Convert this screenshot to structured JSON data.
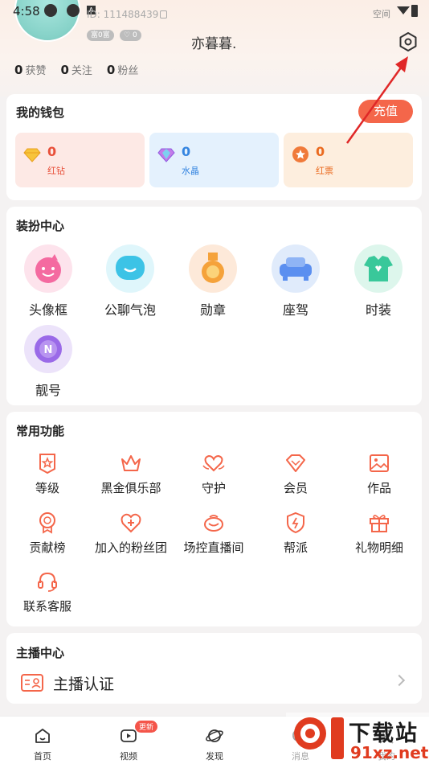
{
  "status_bar": {
    "time": "4:58",
    "network_label": "空间"
  },
  "profile": {
    "user_id": "ID: 111488439",
    "badge_wealth": "富0富",
    "badge_charm": "0",
    "nickname": "亦暮暮.",
    "stats": [
      {
        "count": "0",
        "label": "获赞"
      },
      {
        "count": "0",
        "label": "关注"
      },
      {
        "count": "0",
        "label": "粉丝"
      }
    ],
    "settings_icon": "settings-gear-icon"
  },
  "wallet": {
    "title": "我的钱包",
    "recharge_label": "充值",
    "items": [
      {
        "value": "0",
        "label": "红钻",
        "icon": "diamond-icon",
        "bg": "#fde9e5",
        "fg": "#e8503a"
      },
      {
        "value": "0",
        "label": "水晶",
        "icon": "crystal-icon",
        "bg": "#e4f1fd",
        "fg": "#3585e0"
      },
      {
        "value": "0",
        "label": "红票",
        "icon": "ticket-icon",
        "bg": "#fdeede",
        "fg": "#ea6a1f"
      }
    ]
  },
  "dressup": {
    "title": "装扮中心",
    "items": [
      {
        "label": "头像框",
        "icon": "avatar-frame-icon",
        "bg": "#fde3ec",
        "fg": "#f46aa0"
      },
      {
        "label": "公聊气泡",
        "icon": "chat-bubble-icon",
        "bg": "#dff6fb",
        "fg": "#3cc3e6"
      },
      {
        "label": "勋章",
        "icon": "medal-icon",
        "bg": "#fde9d9",
        "fg": "#f5a23a"
      },
      {
        "label": "座驾",
        "icon": "car-icon",
        "bg": "#e0ebfb",
        "fg": "#5b8ff0"
      },
      {
        "label": "时装",
        "icon": "clothes-icon",
        "bg": "#ddf6ec",
        "fg": "#39c89a"
      },
      {
        "label": "靓号",
        "icon": "vip-number-icon",
        "bg": "#ece3fa",
        "fg": "#9a6ae8"
      }
    ]
  },
  "functions": {
    "title": "常用功能",
    "items": [
      {
        "label": "等级",
        "icon": "level-icon"
      },
      {
        "label": "黑金俱乐部",
        "icon": "crown-icon"
      },
      {
        "label": "守护",
        "icon": "guard-heart-icon"
      },
      {
        "label": "会员",
        "icon": "member-diamond-icon"
      },
      {
        "label": "作品",
        "icon": "image-icon"
      },
      {
        "label": "贡献榜",
        "icon": "ranking-medal-icon"
      },
      {
        "label": "加入的粉丝团",
        "icon": "fan-club-icon"
      },
      {
        "label": "场控直播间",
        "icon": "room-control-icon"
      },
      {
        "label": "帮派",
        "icon": "shield-icon"
      },
      {
        "label": "礼物明细",
        "icon": "gift-icon"
      },
      {
        "label": "联系客服",
        "icon": "headset-icon"
      }
    ],
    "accent": "#f4664a"
  },
  "host_center": {
    "title": "主播中心",
    "verify_label": "主播认证",
    "verify_icon": "id-card-icon"
  },
  "tabbar": {
    "items": [
      {
        "label": "首页",
        "icon": "home-icon"
      },
      {
        "label": "视频",
        "icon": "video-icon"
      },
      {
        "label": "发现",
        "icon": "planet-icon"
      },
      {
        "label": "消息",
        "icon": "message-icon"
      },
      {
        "label": "我的",
        "icon": "user-icon"
      }
    ],
    "new_badge": "更新"
  },
  "watermark": {
    "text": "下载站",
    "url": "91xz.net"
  }
}
